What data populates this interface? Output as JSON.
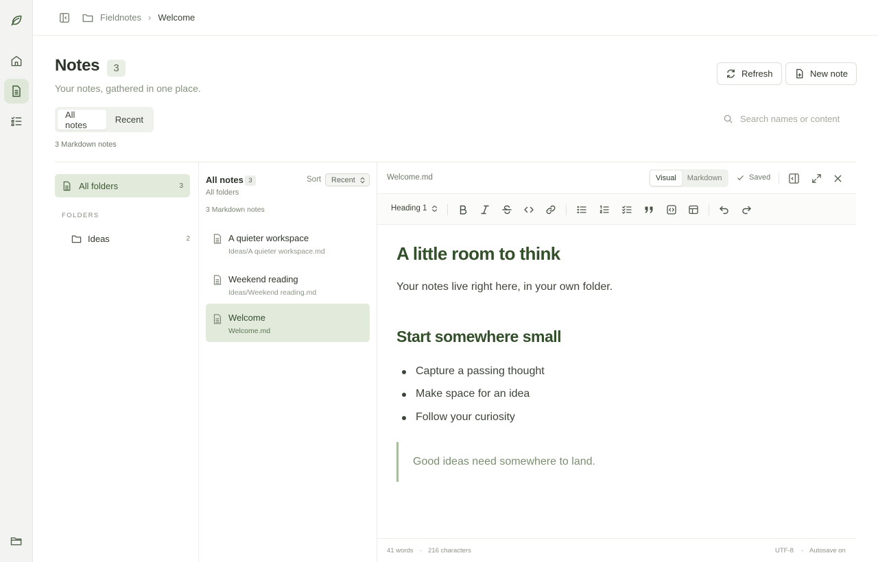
{
  "breadcrumb": {
    "root": "Fieldnotes",
    "current": "Welcome"
  },
  "header": {
    "title": "Notes",
    "count": "3",
    "subtitle": "Your notes, gathered in one place.",
    "refresh_label": "Refresh",
    "new_note_label": "New note"
  },
  "tabs": [
    {
      "label": "All notes",
      "active": true
    },
    {
      "label": "Recent",
      "active": false
    }
  ],
  "search": {
    "placeholder": "Search names or content"
  },
  "caption": "3 Markdown notes",
  "folders": {
    "all_label": "All folders",
    "all_count": "3",
    "section_label": "FOLDERS",
    "items": [
      {
        "label": "Ideas",
        "count": "2"
      }
    ]
  },
  "note_list": {
    "title": "All notes",
    "count": "3",
    "scope": "All folders",
    "sort_label": "Sort",
    "sort_value": "Recent",
    "caption": "3 Markdown notes",
    "items": [
      {
        "title": "A quieter workspace",
        "path": "Ideas/A quieter workspace.md",
        "selected": false
      },
      {
        "title": "Weekend reading",
        "path": "Ideas/Weekend reading.md",
        "selected": false
      },
      {
        "title": "Welcome",
        "path": "Welcome.md",
        "selected": true
      }
    ]
  },
  "editor": {
    "filename": "Welcome.md",
    "modes": [
      {
        "label": "Visual",
        "active": true
      },
      {
        "label": "Markdown",
        "active": false
      }
    ],
    "saved_label": "Saved",
    "block_type": "Heading 1",
    "document": {
      "h1": "A little room to think",
      "paragraph": "Your notes live right here, in your own folder.",
      "h2": "Start somewhere small",
      "bullets": [
        "Capture a passing thought",
        "Make space for an idea",
        "Follow your curiosity"
      ],
      "quote": "Good ideas need somewhere to land."
    },
    "status": {
      "words": "41 words",
      "separator": "·",
      "characters": "216 characters",
      "encoding": "UTF-8",
      "autosave": "Autosave on"
    }
  },
  "colors": {
    "accent": "#34502b",
    "accent_bg": "#e2eadc",
    "rail_bg": "#f3f4f1"
  }
}
